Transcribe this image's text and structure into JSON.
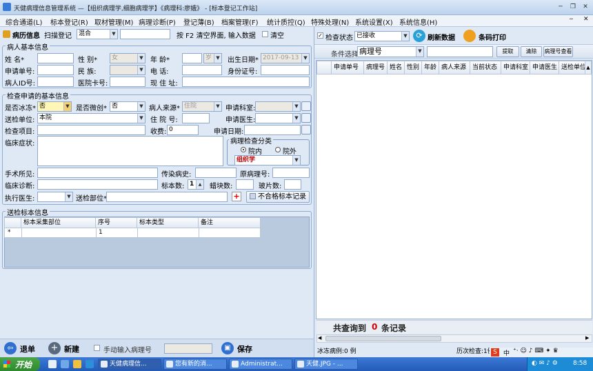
{
  "window": {
    "title": "天健病理信息管理系统 —【组织病理学,细胞病理学】《病理科:廖娥》 - [标本登记工作站]"
  },
  "menu": [
    "综合通道(L)",
    "标本登记(R)",
    "取材管理(M)",
    "病理诊断(P)",
    "登记薄(B)",
    "档案管理(F)",
    "统计质控(Q)",
    "特殊处理(N)",
    "系统设置(X)",
    "系统信息(H)"
  ],
  "toolbar": {
    "history_label": "病历信息",
    "scan_label": "扫描登记",
    "scan_mode": "混合",
    "scan_input": "",
    "hint": "按 F2 清空界面, 输入数据",
    "clear_label": "清空"
  },
  "patient": {
    "section_title": "病人基本信息",
    "name_label": "姓  名*",
    "name": "",
    "sex_label": "性    别*",
    "sex": "女",
    "age_label": "年    龄*",
    "age": "",
    "age_unit": "岁",
    "dob_label": "出生日期*",
    "dob": "2017-09-13",
    "req_no_label": "申请单号:",
    "req_no": "",
    "nation_label": "民    族:",
    "nation": "",
    "phone_label": "电    话:",
    "phone": "",
    "idcard_label": "身份证号:",
    "idcard": "",
    "pid_label": "病人ID号:",
    "pid": "",
    "card_label": "医院卡号:",
    "card": "",
    "addr_label": "现 住 址:",
    "addr": ""
  },
  "exam": {
    "section_title": "检查申请的基本信息",
    "frozen_label": "是否冰冻*",
    "frozen": "否",
    "micro_label": "是否微创*",
    "micro": "否",
    "source_label": "病人来源*",
    "source": "住院",
    "dept_label": "申请科室:",
    "dept": "",
    "send_unit_label": "送检单位:",
    "send_unit": "本院",
    "bed_label": "住 院 号:",
    "bed": "",
    "doctor_label": "申请医生:",
    "doctor": "",
    "item_label": "检查项目:",
    "item": "",
    "fee_label": "收费:",
    "fee": "0",
    "req_date_label": "申请日期:",
    "req_date": "",
    "symptom_label": "临床症状:",
    "symptom": "",
    "category_title": "病理检查分类",
    "in_label": "院内",
    "out_label": "院外",
    "category": "组织学",
    "surgery_label": "手术所见:",
    "surgery": "",
    "infect_label": "传染病史:",
    "infect": "",
    "orig_no_label": "原病理号:",
    "orig_no": "",
    "diag_label": "临床诊断:",
    "diag": "",
    "specimen_count_label": "标本数:",
    "specimen_count": "1",
    "wax_label": "蜡块数:",
    "wax": "",
    "slide_label": "玻片数:",
    "slide": "",
    "exec_doctor_label": "执行医生:",
    "exec_doctor": "",
    "part_label": "送检部位*",
    "part": "",
    "unqualified_label": "不合格标本记录"
  },
  "specimens": {
    "section_title": "送检标本信息",
    "columns": [
      "标本采集部位",
      "序号",
      "标本类型",
      "备注"
    ],
    "rows": [
      {
        "marker": "*",
        "site": "",
        "seq": "1",
        "type": "",
        "note": ""
      }
    ]
  },
  "bottom": {
    "back_label": "退单",
    "new_label": "新建",
    "manual_label": "手动输入病理号",
    "manual_value": "",
    "save_label": "保存"
  },
  "right": {
    "status_label": "检查状态",
    "status": "已接收",
    "refresh_label": "刷新数据",
    "barcode_label": "条码打印",
    "cond_label": "条件选择",
    "cond": "病理号",
    "cond_value": "",
    "fetch_label": "提取",
    "clear_label": "清除",
    "lookup_label": "病理号查看",
    "columns": [
      "申请单号",
      "病理号",
      "姓名",
      "性别",
      "年龄",
      "病人来源",
      "当前状态",
      "申请科室",
      "申请医生",
      "送检单位"
    ],
    "total_prefix": "共查询到",
    "total_count": "0",
    "total_suffix": "条记录",
    "frozen_status": "冰冻病例:0 例",
    "history_status": "历次检查:1例"
  },
  "taskbar": {
    "start": "开始",
    "tasks": [
      "天健病理信...",
      "您有新的消...",
      "Administrat...",
      "天健.JPG - ..."
    ],
    "time": "8:58",
    "ime": "中"
  },
  "colors": {
    "accent": "#2b66c4",
    "red": "#d40000",
    "category_text": "#c00000"
  }
}
